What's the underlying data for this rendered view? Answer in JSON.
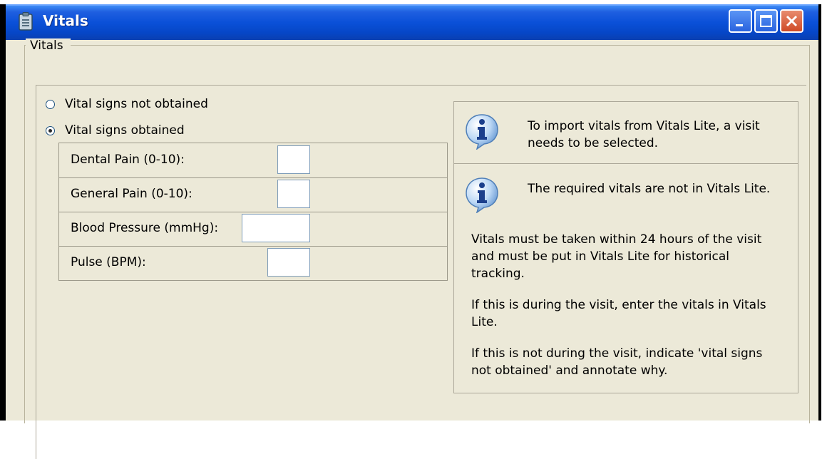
{
  "window": {
    "title": "Vitals",
    "icons": {
      "app": "clipboard-icon",
      "minimize": "minimize-icon",
      "maximize": "maximize-icon",
      "close": "close-icon"
    }
  },
  "group": {
    "label": "Vitals"
  },
  "radios": [
    {
      "label": "Vital signs not obtained",
      "checked": false
    },
    {
      "label": "Vital signs obtained",
      "checked": true
    }
  ],
  "fields": [
    {
      "label": "Dental Pain (0-10):",
      "value": ""
    },
    {
      "label": "General Pain (0-10):",
      "value": ""
    },
    {
      "label": "Blood Pressure (mmHg):",
      "value": ""
    },
    {
      "label": "Pulse (BPM):",
      "value": ""
    }
  ],
  "info": {
    "import_message": "To import vitals from Vitals Lite, a visit needs to be selected.",
    "required_message": "The required vitals are not in Vitals Lite.",
    "paragraphs": [
      "Vitals must be taken within 24 hours of the visit and must be put in Vitals Lite for historical tracking.",
      "If this is during the visit, enter the vitals in Vitals Lite.",
      "If this is not during the visit, indicate 'vital signs not obtained' and annotate why."
    ],
    "icon": "info-icon"
  },
  "colors": {
    "titlebar": "#0a50d8",
    "window_bg": "#ece9d8",
    "close_button": "#cf4a26"
  }
}
